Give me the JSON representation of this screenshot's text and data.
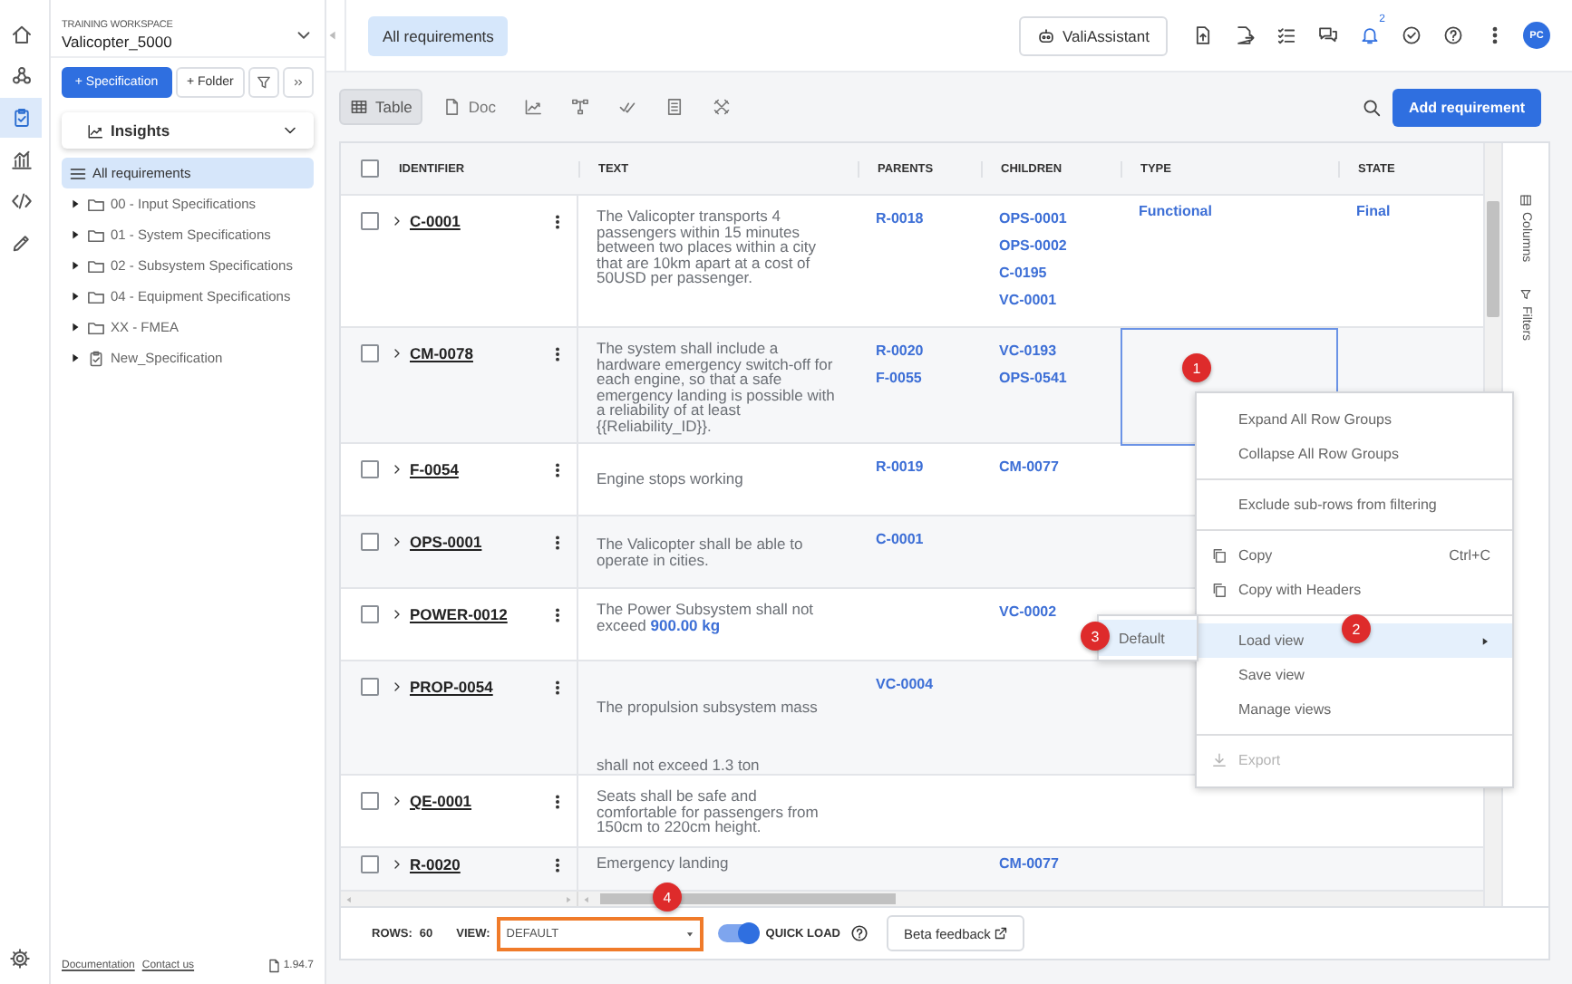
{
  "rail": {
    "items": [
      {
        "selected": false
      },
      {
        "selected": false
      },
      {
        "selected": true
      },
      {
        "selected": false
      },
      {
        "selected": false
      },
      {
        "selected": false
      }
    ]
  },
  "sidebar": {
    "workspace_label": "TRAINING WORKSPACE",
    "workspace_name": "Valicopter_5000",
    "buttons": [
      "+ Specification",
      "+ Folder"
    ],
    "insights": "Insights",
    "tree": [
      {
        "kind": "list",
        "label": "All requirements",
        "selected": true
      },
      {
        "kind": "folder",
        "label": "00 - Input Specifications",
        "selected": false,
        "expanded": false
      },
      {
        "kind": "folder",
        "label": "01 - System Specifications",
        "selected": false,
        "expanded": false
      },
      {
        "kind": "folder",
        "label": "02 - Subsystem Specifications",
        "selected": false,
        "expanded": false
      },
      {
        "kind": "folder",
        "label": "04 - Equipment Specifications",
        "selected": false,
        "expanded": false
      },
      {
        "kind": "folder",
        "label": "XX - FMEA",
        "selected": false,
        "expanded": false
      },
      {
        "kind": "specification",
        "label": "New_Specification",
        "selected": false,
        "expanded": false
      }
    ],
    "links": [
      "Documentation",
      "Contact us"
    ],
    "version": "1.94.7"
  },
  "top_bar": {
    "tab": {
      "label": "All requirements",
      "selected": true
    },
    "assistant": "ValiAssistant",
    "notification_count": "2",
    "avatar": "PC"
  },
  "toolbar": {
    "views": [
      {
        "kind": "labeled",
        "label": "Table",
        "selected": true
      },
      {
        "kind": "labeled",
        "label": "Doc",
        "selected": false
      }
    ],
    "add_button": "Add requirement"
  },
  "table": {
    "select_all_checked": false,
    "columns": [
      "IDENTIFIER",
      "TEXT",
      "PARENTS",
      "CHILDREN",
      "TYPE",
      "STATE"
    ],
    "rows": [
      {
        "id": "C-0001",
        "checked": false,
        "text": "The Valicopter transports 4 passengers within 15 minutes between two places within a city that are 10km apart at a cost of 50USD per passenger.",
        "parents": [
          "R-0018"
        ],
        "children": [
          "OPS-0001",
          "OPS-0002",
          "C-0195",
          "VC-0001"
        ],
        "type": "Functional",
        "state": "Final",
        "type_focused": false
      },
      {
        "id": "CM-0078",
        "checked": false,
        "text": "The system shall include a hardware emergency switch-off for each engine, so that a safe emergency landing is possible with a reliability of at least {{Reliability_ID}}.",
        "parents": [
          "R-0020",
          "F-0055"
        ],
        "children": [
          "VC-0193",
          "OPS-0541"
        ],
        "type_focused": true
      },
      {
        "id": "F-0054",
        "checked": false,
        "text": "Engine stops working",
        "parents": [
          "R-0019"
        ],
        "children": [
          "CM-0077"
        ],
        "type_focused": false
      },
      {
        "id": "OPS-0001",
        "checked": false,
        "text": "The Valicopter shall be able to operate in cities.",
        "parents": [
          "C-0001"
        ],
        "children": [],
        "type_focused": false
      },
      {
        "id": "POWER-0012",
        "checked": false,
        "text": "The Power Subsystem shall not exceed",
        "value": "900.00  kg",
        "parents": [],
        "children": [
          "VC-0002"
        ],
        "type_focused": false
      },
      {
        "id": "PROP-0054",
        "checked": false,
        "text": "The propulsion subsystem mass",
        "text_continued": "shall not exceed 1.3 ton",
        "parents": [
          "VC-0004"
        ],
        "children": [],
        "type_focused": false
      },
      {
        "id": "QE-0001",
        "checked": false,
        "text": "Seats shall be safe and comfortable for passengers from 150cm to 220cm height.",
        "parents": [],
        "children": [],
        "type_focused": false
      },
      {
        "id": "R-0020",
        "checked": false,
        "text": "Emergency landing",
        "parents": [],
        "children": [
          "CM-0077"
        ],
        "type_focused": false
      }
    ]
  },
  "side_panel": [
    "Columns",
    "Filters"
  ],
  "context_menu": {
    "items": [
      {
        "kind": "item",
        "label": "Expand All Row Groups",
        "highlighted": false,
        "disabled": false
      },
      {
        "kind": "item",
        "label": "Collapse All Row Groups",
        "highlighted": false,
        "disabled": false
      },
      {
        "kind": "separator"
      },
      {
        "kind": "item",
        "label": "Exclude sub-rows from filtering",
        "highlighted": false,
        "disabled": false
      },
      {
        "kind": "separator"
      },
      {
        "kind": "copy",
        "label": "Copy",
        "shortcut": "Ctrl+C",
        "highlighted": false,
        "disabled": false
      },
      {
        "kind": "copy",
        "label": "Copy with Headers",
        "highlighted": false,
        "disabled": false
      },
      {
        "kind": "separator"
      },
      {
        "kind": "submenu",
        "label": "Load view",
        "highlighted": true,
        "disabled": false
      },
      {
        "kind": "item",
        "label": "Save view",
        "highlighted": false,
        "disabled": false
      },
      {
        "kind": "item",
        "label": "Manage views",
        "highlighted": false,
        "disabled": false
      },
      {
        "kind": "separator"
      },
      {
        "kind": "export",
        "label": "Export",
        "highlighted": false,
        "disabled": true
      }
    ]
  },
  "submenu": [
    {
      "label": "Default",
      "highlighted": true
    }
  ],
  "badges": [
    "1",
    "2",
    "3",
    "4"
  ],
  "footer": {
    "rows_label": "ROWS:",
    "rows_value": "60",
    "view_label": "VIEW:",
    "view_value": "DEFAULT",
    "view_highlighted": true,
    "quick_load": {
      "label": "QUICK LOAD",
      "on": true
    },
    "feedback": "Beta feedback"
  }
}
